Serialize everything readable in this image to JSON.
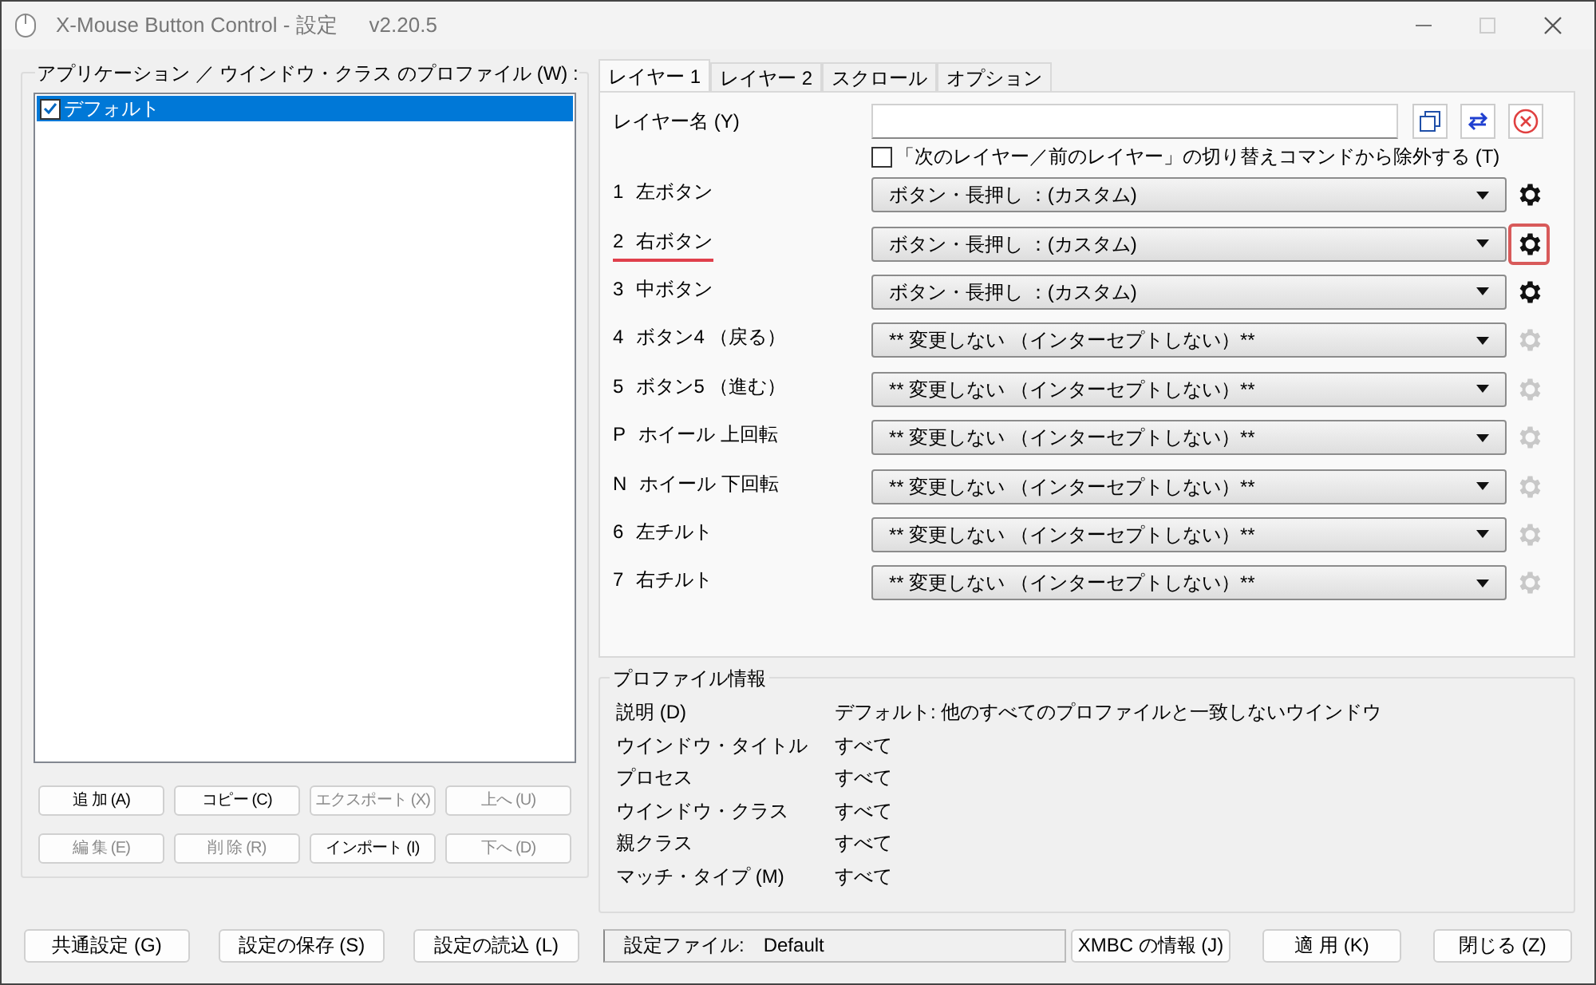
{
  "window": {
    "title": "X-Mouse Button Control - 設定",
    "version": "v2.20.5"
  },
  "profiles": {
    "label": "アプリケーション ／ ウインドウ・クラス のプロファイル (W) :",
    "items": [
      {
        "label": "デフォルト",
        "checked": true,
        "selected": true
      }
    ]
  },
  "profile_buttons": [
    {
      "label": "追 加 (A)",
      "disabled": false
    },
    {
      "label": "コピー (C)",
      "disabled": false
    },
    {
      "label": "エクスポート (X)",
      "disabled": true
    },
    {
      "label": "上へ (U)",
      "disabled": true
    },
    {
      "label": "編 集 (E)",
      "disabled": true
    },
    {
      "label": "削 除 (R)",
      "disabled": true
    },
    {
      "label": "インポート (I)",
      "disabled": false
    },
    {
      "label": "下へ (D)",
      "disabled": true
    }
  ],
  "tabs": [
    {
      "label": "レイヤー 1",
      "selected": true
    },
    {
      "label": "レイヤー 2",
      "selected": false
    },
    {
      "label": "スクロール",
      "selected": false
    },
    {
      "label": "オプション",
      "selected": false
    }
  ],
  "layer_name": {
    "label": "レイヤー名 (Y)"
  },
  "exclude_checkbox": {
    "label": "「次のレイヤー／前のレイヤー」の切り替えコマンドから除外する (T)",
    "checked": false
  },
  "mappings": [
    {
      "key": "1",
      "label": "左ボタン",
      "value": "ボタン・長押し ：(カスタム)",
      "settings_enabled": true,
      "highlighted": false
    },
    {
      "key": "2",
      "label": "右ボタン",
      "value": "ボタン・長押し ：(カスタム)",
      "settings_enabled": true,
      "highlighted": true
    },
    {
      "key": "3",
      "label": "中ボタン",
      "value": "ボタン・長押し ：(カスタム)",
      "settings_enabled": true,
      "highlighted": false
    },
    {
      "key": "4",
      "label": "ボタン4 （戻る）",
      "value": "** 変更しない （インターセプトしない）**",
      "settings_enabled": false,
      "highlighted": false
    },
    {
      "key": "5",
      "label": "ボタン5 （進む）",
      "value": "** 変更しない （インターセプトしない）**",
      "settings_enabled": false,
      "highlighted": false
    },
    {
      "key": "P",
      "label": "ホイール 上回転",
      "value": "** 変更しない （インターセプトしない）**",
      "settings_enabled": false,
      "highlighted": false
    },
    {
      "key": "N",
      "label": "ホイール 下回転",
      "value": "** 変更しない （インターセプトしない）**",
      "settings_enabled": false,
      "highlighted": false
    },
    {
      "key": "6",
      "label": "左チルト",
      "value": "** 変更しない （インターセプトしない）**",
      "settings_enabled": false,
      "highlighted": false
    },
    {
      "key": "7",
      "label": "右チルト",
      "value": "** 変更しない （インターセプトしない）**",
      "settings_enabled": false,
      "highlighted": false
    }
  ],
  "profile_info": {
    "title": "プロファイル情報",
    "rows": [
      {
        "label": "説明 (D)",
        "value": "デフォルト: 他のすべてのプロファイルと一致しないウインドウ"
      },
      {
        "label": "ウインドウ・タイトル",
        "value": "すべて"
      },
      {
        "label": "プロセス",
        "value": "すべて"
      },
      {
        "label": "ウインドウ・クラス",
        "value": "すべて"
      },
      {
        "label": "親クラス",
        "value": "すべて"
      },
      {
        "label": "マッチ・タイプ (M)",
        "value": "すべて"
      }
    ]
  },
  "bottom_buttons_left": [
    "共通設定 (G)",
    "設定の保存 (S)",
    "設定の読込 (L)"
  ],
  "settings_file": {
    "label": "設定ファイル:",
    "value": "Default"
  },
  "bottom_buttons_right": [
    "XMBC の情報 (J)",
    "適 用 (K)",
    "閉じる (Z)"
  ]
}
